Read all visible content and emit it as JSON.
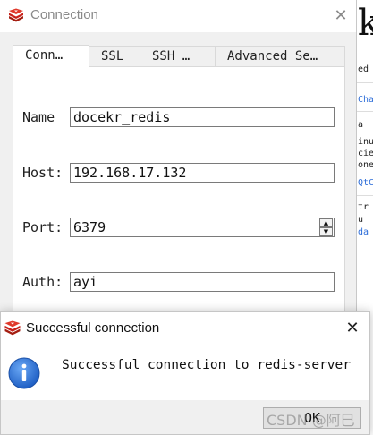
{
  "connection_window": {
    "title": "Connection",
    "close_glyph": "✕",
    "tabs": [
      {
        "label": "Conn…",
        "active": true
      },
      {
        "label": "SSL",
        "active": false
      },
      {
        "label": "SSH …",
        "active": false
      },
      {
        "label": "Advanced Se…",
        "active": false
      }
    ],
    "form": {
      "name_label": "Name",
      "name_value": "docekr_redis",
      "host_label": "Host:",
      "host_value": "192.168.17.132",
      "port_label": "Port:",
      "port_value": "6379",
      "auth_label": "Auth:",
      "auth_value": "ayi"
    }
  },
  "message_dialog": {
    "title": "Successful connection",
    "close_glyph": "✕",
    "message": "Successful connection to redis-server",
    "ok_label": "OK",
    "icon": "info-icon"
  },
  "background_doc": {
    "big_glyph": "k",
    "lines": [
      "ed",
      "Cha",
      "a",
      "inu",
      "cie",
      "one",
      "QtC",
      "tr",
      "u",
      "da"
    ]
  },
  "watermark": "CSDN @阿巳",
  "colors": {
    "redis_red": "#c8201a",
    "info_blue": "#2a6fd0",
    "window_bg": "#f0f0f0"
  }
}
